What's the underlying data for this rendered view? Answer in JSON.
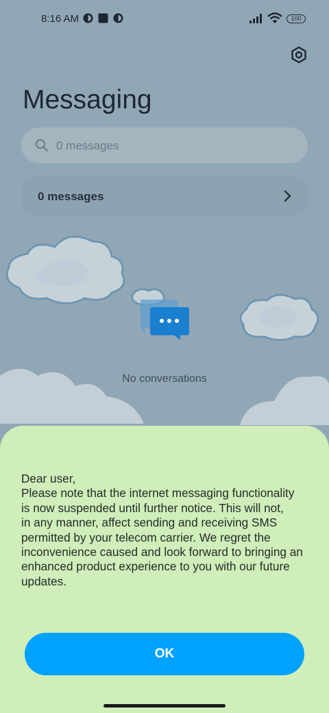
{
  "status_bar": {
    "time": "8:16 AM",
    "battery": "100",
    "icons": [
      "notification-app-icon",
      "square-notification-icon",
      "notification-app-icon",
      "signal-icon",
      "wifi-icon",
      "battery-icon"
    ]
  },
  "header": {
    "title": "Messaging",
    "settings_icon": "settings-gear-icon"
  },
  "search": {
    "placeholder": "0 messages",
    "icon": "search-icon"
  },
  "messages_card": {
    "label": "0 messages",
    "icon": "chevron-right-icon"
  },
  "empty_state": {
    "icon": "chat-bubbles-icon",
    "text": "No conversations"
  },
  "dialog": {
    "lines": [
      "Dear user,",
      "Please note that the internet messaging functionality",
      "is now suspended until further notice. This will not,",
      "in any manner, affect sending and receiving SMS",
      "permitted by your telecom carrier. We regret the",
      "inconvenience caused and look forward to bringing an",
      "enhanced product experience to you with our future",
      "updates."
    ],
    "ok_label": "OK"
  },
  "colors": {
    "background": "#92a7b6",
    "sheet": "#cfeeb9",
    "ok_button": "#00a2ff",
    "chat_icon": "#1a7fcf"
  }
}
